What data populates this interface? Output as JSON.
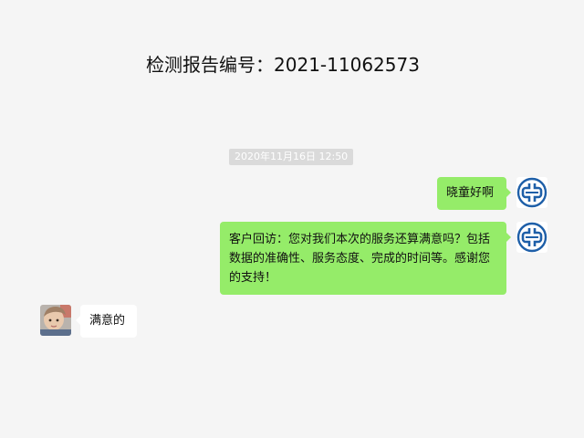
{
  "header": {
    "title": "检测报告编号：2021-11062573"
  },
  "chat": {
    "timestamp": "2020年11月16日 12:50",
    "messages": [
      {
        "side": "right",
        "sender_avatar": "company-logo-icon",
        "text": "晓童好啊"
      },
      {
        "side": "right",
        "sender_avatar": "company-logo-icon",
        "text": "客户回访：您对我们本次的服务还算满意吗？包括数据的准确性、服务态度、完成的时间等。感谢您的支持！"
      },
      {
        "side": "left",
        "sender_avatar": "child-photo-avatar",
        "text": "满意的"
      }
    ]
  },
  "colors": {
    "background": "#f5f5f5",
    "outgoing_bubble": "#95ec69",
    "incoming_bubble": "#ffffff",
    "timestamp_bg": "#dadada",
    "logo_blue": "#1e5fa8"
  }
}
